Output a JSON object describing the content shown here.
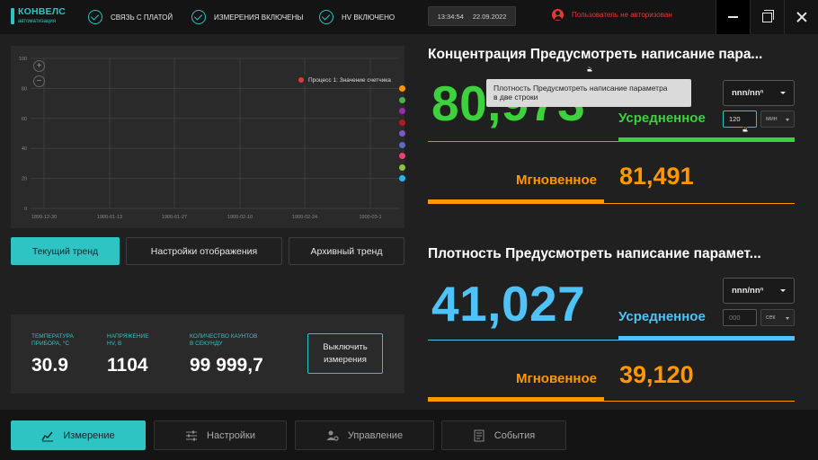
{
  "header": {
    "logo_name": "КОНВЕЛС",
    "logo_sub": "автоматизация",
    "statuses": [
      {
        "label": "СВЯЗЬ С ПЛАТОЙ"
      },
      {
        "label": "ИЗМЕРЕНИЯ ВКЛЮЧЕНЫ"
      },
      {
        "label": "HV ВКЛЮЧЕНО"
      }
    ],
    "time": "13:34:54",
    "date": "22.09.2022",
    "user_status": "Пользователь не авторизован"
  },
  "chart_data": {
    "type": "line",
    "y_ticks": [
      "100",
      "80",
      "60",
      "40",
      "20",
      "0"
    ],
    "ylim": [
      0,
      100
    ],
    "x_ticks": [
      "1899-12-30",
      "1900-01-13",
      "1900-01-27",
      "1900-02-10",
      "1900-02-24",
      "1900-03-1"
    ],
    "series": [
      {
        "name": "Процесс 1: Значение счетчика",
        "values": []
      }
    ],
    "legend": "top-right",
    "grid": true,
    "series_colors": [
      "#ff9800",
      "#4caf50",
      "#9c27b0",
      "#b71c1c",
      "#7e57c2",
      "#5c6bc0",
      "#ec407a",
      "#8bc34a",
      "#29b6f6"
    ]
  },
  "left_buttons": {
    "current_trend": "Текущий тренд",
    "display_settings": "Настройки отображения",
    "archive_trend": "Архивный тренд"
  },
  "info": {
    "items": [
      {
        "label_line1": "ТЕМПЕРАТУРА",
        "label_line2": "ПРИБОРА, °С",
        "value": "30.9"
      },
      {
        "label_line1": "НАПРЯЖЕНИЕ",
        "label_line2": "HV, В",
        "value": "1104"
      },
      {
        "label_line1": "КОЛИЧЕСТВО КАУНТОВ",
        "label_line2": "В СЕКУНДУ",
        "value": "99 999,7"
      }
    ],
    "stop_line1": "Выключить",
    "stop_line2": "измерения"
  },
  "metrics": [
    {
      "title": "Концентрация Предусмотреть написание пара...",
      "big_value": "80,973",
      "big_color": "#3dd13d",
      "unit": "nnn/nnⁿ",
      "avg_label": "Усредненное",
      "avg_input": "120",
      "avg_unit": "мин",
      "inst_label": "Мгновенное",
      "inst_value": "81,491"
    },
    {
      "title": "Плотность Предусмотреть написание парамет...",
      "big_value": "41,027",
      "big_color": "#4fc3f7",
      "unit": "nnn/nnⁿ",
      "avg_label": "Усредненное",
      "avg_input_placeholder": "000",
      "avg_unit": "сек",
      "inst_label": "Мгновенное",
      "inst_value": "39,120"
    }
  ],
  "tooltip": {
    "line1": "Плотность Предусмотреть написание параметра",
    "line2": "в две строки"
  },
  "nav": [
    {
      "label": "Измерение",
      "icon": "chart-line-icon",
      "active": true
    },
    {
      "label": "Настройки",
      "icon": "sliders-icon",
      "active": false
    },
    {
      "label": "Управление",
      "icon": "user-gear-icon",
      "active": false
    },
    {
      "label": "События",
      "icon": "list-icon",
      "active": false
    }
  ]
}
